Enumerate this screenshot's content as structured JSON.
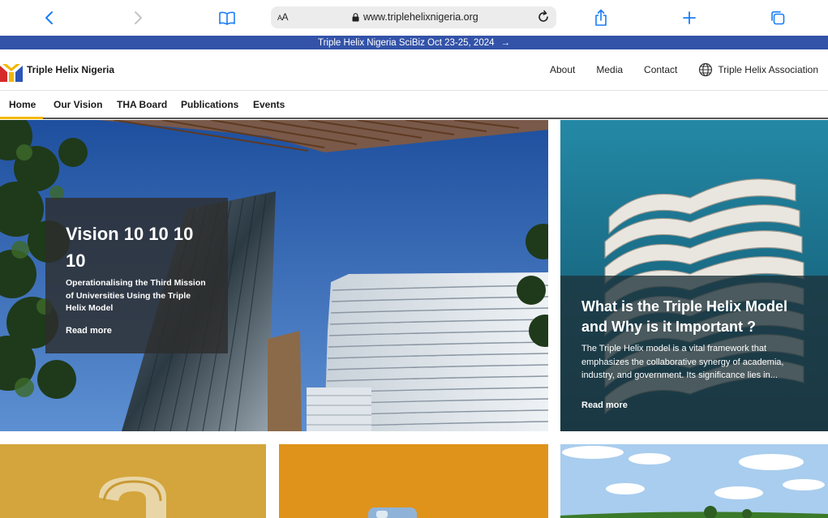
{
  "browser": {
    "url": "www.triplehelixnigeria.org",
    "text_size_label": "AA",
    "accent_color": "#1a7cf5",
    "icons": [
      "back-icon",
      "forward-icon",
      "book-icon",
      "lock-icon",
      "reload-icon",
      "share-icon",
      "plus-icon",
      "tabs-icon"
    ]
  },
  "banner": {
    "text": "Triple Helix Nigeria SciBiz Oct 23-25, 2024",
    "arrow": "→",
    "color": "#3353a8"
  },
  "header": {
    "brand": "Triple Helix Nigeria",
    "links": [
      "About",
      "Media",
      "Contact"
    ],
    "association": "Triple Helix Association"
  },
  "nav": {
    "items": [
      "Home",
      "Our Vision",
      "THA Board",
      "Publications",
      "Events"
    ],
    "active": "Home",
    "active_color": "#f2b705"
  },
  "hero": {
    "left": {
      "title": "Vision 10 10 10 10",
      "subtitle": "Operationalising the Third Mission of Universities Using the Triple Helix Model",
      "read_more": "Read more"
    },
    "right": {
      "title": "What is the Triple Helix Model and Why is it Important ?",
      "summary": "The Triple Helix model is a vital framework that emphasizes the collaborative synergy of academia, industry, and government. Its significance lies in...",
      "read_more": "Read more"
    }
  }
}
